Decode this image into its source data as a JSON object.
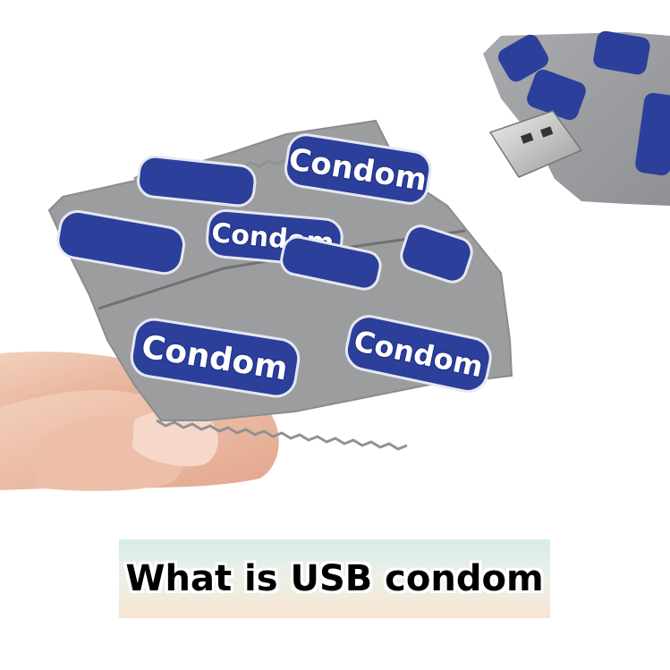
{
  "photo": {
    "subject": "usb-flash-drive-shaped-like-condom-wrapper",
    "colors": {
      "wrapper_gray": "#9b9d9f",
      "logo_blue": "#2c3f9a",
      "skin": "#f0c6b0",
      "usb_metal": "#c9c9c9"
    },
    "logo_text": "Condom"
  },
  "caption": {
    "text": "What is USB condom"
  }
}
